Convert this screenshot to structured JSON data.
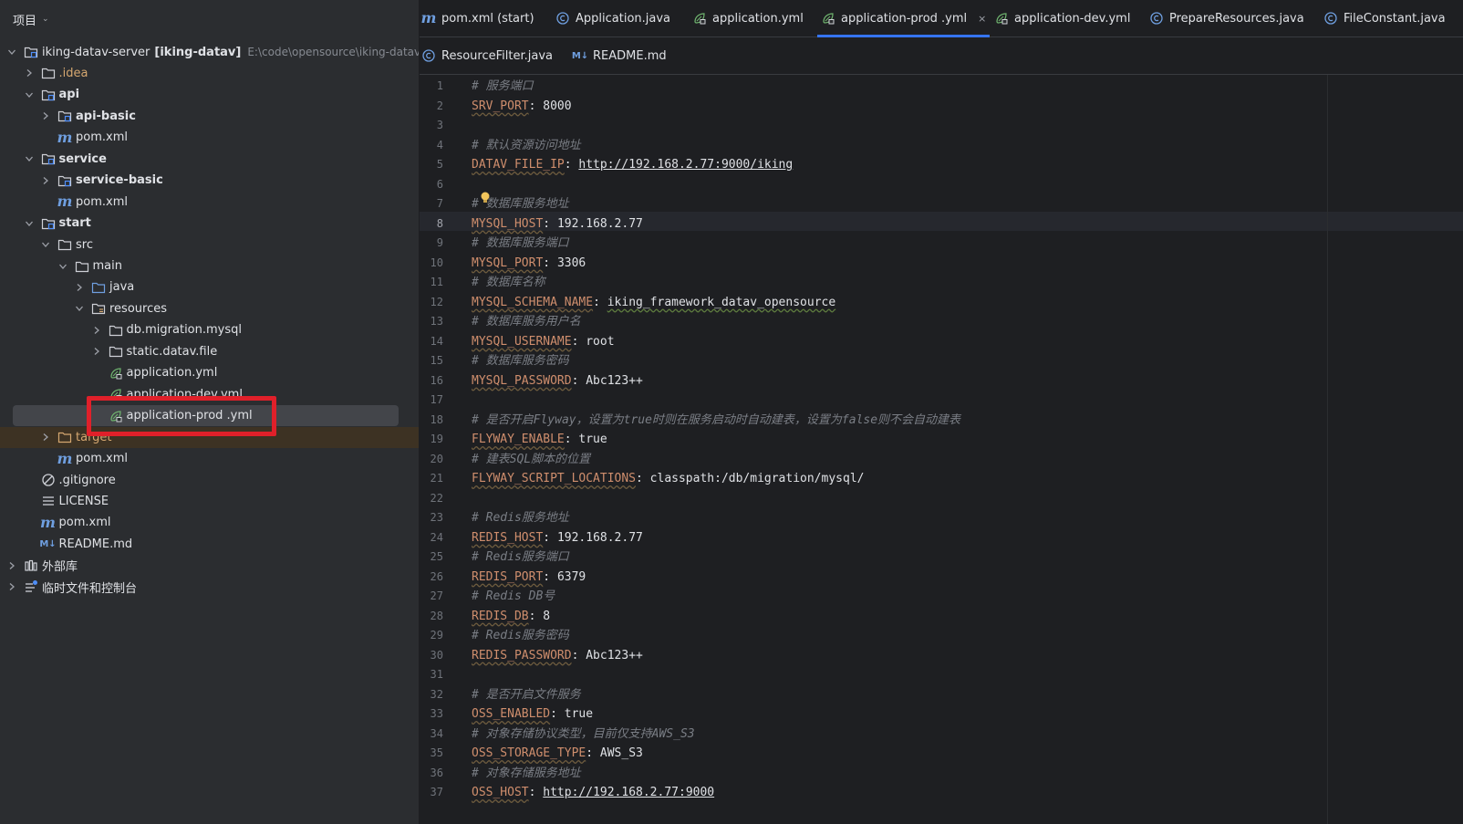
{
  "project_panel": {
    "title": "项目",
    "tree": [
      {
        "label": "iking-datav-server",
        "extra_bold": "[iking-datav]",
        "extra": "E:\\code\\opensource\\iking-datav-server",
        "icon": "module-folder-icon",
        "arrow": "down",
        "depth": 0,
        "bold": false
      },
      {
        "label": ".idea",
        "icon": "folder-icon",
        "arrow": "right",
        "depth": 1,
        "style": "idea"
      },
      {
        "label": "api",
        "icon": "module-folder-icon",
        "arrow": "down",
        "depth": 1,
        "bold": true
      },
      {
        "label": "api-basic",
        "icon": "module-folder-icon",
        "arrow": "right",
        "depth": 2,
        "bold": true
      },
      {
        "label": "pom.xml",
        "icon": "maven-icon",
        "arrow": "none",
        "depth": 2
      },
      {
        "label": "service",
        "icon": "module-folder-icon",
        "arrow": "down",
        "depth": 1,
        "bold": true
      },
      {
        "label": "service-basic",
        "icon": "module-folder-icon",
        "arrow": "right",
        "depth": 2,
        "bold": true
      },
      {
        "label": "pom.xml",
        "icon": "maven-icon",
        "arrow": "none",
        "depth": 2
      },
      {
        "label": "start",
        "icon": "module-folder-icon",
        "arrow": "down",
        "depth": 1,
        "bold": true
      },
      {
        "label": "src",
        "icon": "folder-icon",
        "arrow": "down",
        "depth": 2
      },
      {
        "label": "main",
        "icon": "folder-icon",
        "arrow": "down",
        "depth": 3
      },
      {
        "label": "java",
        "icon": "source-folder-icon",
        "arrow": "right",
        "depth": 4
      },
      {
        "label": "resources",
        "icon": "resources-folder-icon",
        "arrow": "down",
        "depth": 4
      },
      {
        "label": "db.migration.mysql",
        "icon": "folder-icon",
        "arrow": "right",
        "depth": 5
      },
      {
        "label": "static.datav.file",
        "icon": "folder-icon",
        "arrow": "right",
        "depth": 5
      },
      {
        "label": "application.yml",
        "icon": "spring-yml-icon",
        "arrow": "none",
        "depth": 5
      },
      {
        "label": "application-dev.yml",
        "icon": "spring-yml-icon",
        "arrow": "none",
        "depth": 5
      },
      {
        "label": "application-prod .yml",
        "icon": "spring-yml-icon",
        "arrow": "none",
        "depth": 5,
        "selected": true
      },
      {
        "label": "target",
        "icon": "excluded-folder-icon",
        "arrow": "right",
        "depth": 2,
        "style": "target"
      },
      {
        "label": "pom.xml",
        "icon": "maven-icon",
        "arrow": "none",
        "depth": 2
      },
      {
        "label": ".gitignore",
        "icon": "gitignore-icon",
        "arrow": "none",
        "depth": 1
      },
      {
        "label": "LICENSE",
        "icon": "text-file-icon",
        "arrow": "none",
        "depth": 1
      },
      {
        "label": "pom.xml",
        "icon": "maven-icon",
        "arrow": "none",
        "depth": 1
      },
      {
        "label": "README.md",
        "icon": "markdown-icon",
        "arrow": "none",
        "depth": 1
      },
      {
        "label": "外部库",
        "icon": "library-icon",
        "arrow": "right",
        "depth": 0
      },
      {
        "label": "临时文件和控制台",
        "icon": "scratches-icon",
        "arrow": "right",
        "depth": 0
      }
    ]
  },
  "tabs_row_1": [
    {
      "label": "pom.xml (start)",
      "icon": "maven-icon"
    },
    {
      "label": "Application.java",
      "icon": "java-class-icon"
    },
    {
      "label": "application.yml",
      "icon": "spring-yml-icon"
    },
    {
      "label": "application-prod .yml",
      "icon": "spring-yml-icon",
      "active": true,
      "close": "×"
    },
    {
      "label": "application-dev.yml",
      "icon": "spring-yml-icon"
    },
    {
      "label": "PrepareResources.java",
      "icon": "java-class-icon"
    },
    {
      "label": "FileConstant.java",
      "icon": "java-class-icon"
    }
  ],
  "tabs_row_2": [
    {
      "label": "ResourceFilter.java",
      "icon": "java-class-icon"
    },
    {
      "label": "README.md",
      "icon": "markdown-icon"
    }
  ],
  "icon_glyphs": {
    "maven": "m",
    "markdown": "M↓"
  },
  "editor": {
    "current_line": 8,
    "lines": [
      {
        "n": "1",
        "type": "comment",
        "text": "# 服务端口"
      },
      {
        "n": "2",
        "type": "kv",
        "key": "SRV_PORT",
        "value": "8000"
      },
      {
        "n": "3",
        "type": "blank"
      },
      {
        "n": "4",
        "type": "comment",
        "text": "# 默认资源访问地址"
      },
      {
        "n": "5",
        "type": "kv",
        "key": "DATAV_FILE_IP",
        "value": "http://192.168.2.77:9000/iking",
        "vstyle": "url"
      },
      {
        "n": "6",
        "type": "blank"
      },
      {
        "n": "7",
        "type": "comment",
        "text": "# 数据库服务地址"
      },
      {
        "n": "8",
        "type": "kv",
        "key": "MYSQL_HOST",
        "value": "192.168.2.77"
      },
      {
        "n": "9",
        "type": "comment",
        "text": "# 数据库服务端口"
      },
      {
        "n": "10",
        "type": "kv",
        "key": "MYSQL_PORT",
        "value": "3306"
      },
      {
        "n": "11",
        "type": "comment",
        "text": "# 数据库名称"
      },
      {
        "n": "12",
        "type": "kv",
        "key": "MYSQL_SCHEMA_NAME",
        "value": "iking_framework_datav_opensource",
        "vstyle": "typo"
      },
      {
        "n": "13",
        "type": "comment",
        "text": "# 数据库服务用户名"
      },
      {
        "n": "14",
        "type": "kv",
        "key": "MYSQL_USERNAME",
        "value": "root"
      },
      {
        "n": "15",
        "type": "comment",
        "text": "# 数据库服务密码"
      },
      {
        "n": "16",
        "type": "kv",
        "key": "MYSQL_PASSWORD",
        "value": "Abc123++"
      },
      {
        "n": "17",
        "type": "blank"
      },
      {
        "n": "18",
        "type": "comment",
        "text": "# 是否开启Flyway，设置为true时则在服务启动时自动建表，设置为false则不会自动建表"
      },
      {
        "n": "19",
        "type": "kv",
        "key": "FLYWAY_ENABLE",
        "value": "true"
      },
      {
        "n": "20",
        "type": "comment",
        "text": "# 建表SQL脚本的位置"
      },
      {
        "n": "21",
        "type": "kv",
        "key": "FLYWAY_SCRIPT_LOCATIONS",
        "value": "classpath:/db/migration/mysql/"
      },
      {
        "n": "22",
        "type": "blank"
      },
      {
        "n": "23",
        "type": "comment",
        "text": "# Redis服务地址"
      },
      {
        "n": "24",
        "type": "kv",
        "key": "REDIS_HOST",
        "value": "192.168.2.77"
      },
      {
        "n": "25",
        "type": "comment",
        "text": "# Redis服务端口"
      },
      {
        "n": "26",
        "type": "kv",
        "key": "REDIS_PORT",
        "value": "6379"
      },
      {
        "n": "27",
        "type": "comment",
        "text": "# Redis DB号"
      },
      {
        "n": "28",
        "type": "kv",
        "key": "REDIS_DB",
        "value": "8"
      },
      {
        "n": "29",
        "type": "comment",
        "text": "# Redis服务密码"
      },
      {
        "n": "30",
        "type": "kv",
        "key": "REDIS_PASSWORD",
        "value": "Abc123++"
      },
      {
        "n": "31",
        "type": "blank"
      },
      {
        "n": "32",
        "type": "comment",
        "text": "# 是否开启文件服务"
      },
      {
        "n": "33",
        "type": "kv",
        "key": "OSS_ENABLED",
        "value": "true"
      },
      {
        "n": "34",
        "type": "comment",
        "text": "# 对象存储协议类型，目前仅支持AWS_S3"
      },
      {
        "n": "35",
        "type": "kv",
        "key": "OSS_STORAGE_TYPE",
        "value": "AWS_S3"
      },
      {
        "n": "36",
        "type": "comment",
        "text": "# 对象存储服务地址"
      },
      {
        "n": "37",
        "type": "kv",
        "key": "OSS_HOST",
        "value": "http://192.168.2.77:9000",
        "vstyle": "url"
      }
    ]
  },
  "colors": {
    "accent": "#3574f0",
    "highlight_box": "#e0202a",
    "yaml_key": "#cf8e6d",
    "comment": "#7a7e85"
  }
}
